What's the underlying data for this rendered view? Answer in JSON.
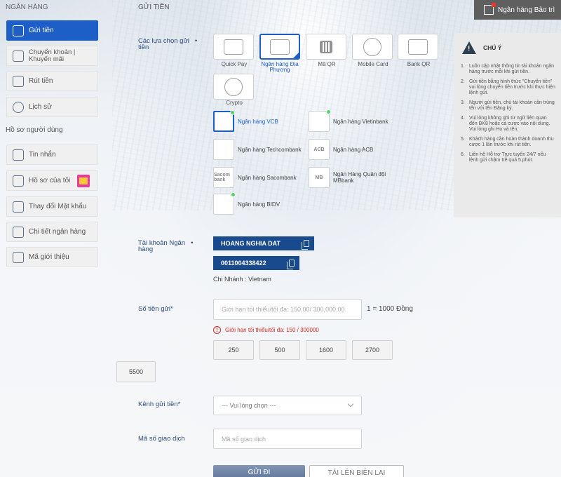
{
  "sidebar": {
    "title": "NGÂN HÀNG",
    "items": [
      {
        "label": "Gửi tiền",
        "icon": "deposit-icon"
      },
      {
        "label": "Chuyển khoản |",
        "label2": "Khuyến mãi",
        "icon": "transfer-icon"
      },
      {
        "label": "Rút tiền",
        "icon": "withdraw-icon"
      },
      {
        "label": "Lịch sử",
        "icon": "history-icon"
      }
    ],
    "profile_section": "Hồ sơ người dùng",
    "profile_items": [
      {
        "label": "Tin nhắn",
        "icon": "mail-icon"
      },
      {
        "label": "Hồ sơ của tôi",
        "icon": "profile-icon"
      },
      {
        "label": "Thay đổi Mật khẩu",
        "icon": "password-icon"
      },
      {
        "label": "Chi tiết ngân hàng",
        "icon": "bank-detail-icon"
      },
      {
        "label": "Mã giới thiệu",
        "icon": "referral-icon"
      }
    ]
  },
  "header": {
    "title": "GỬI TIỀN",
    "maintenance_label": "Ngân hàng Bảo trì"
  },
  "deposit": {
    "options_label": "Các lựa chọn gửi",
    "options_label2": "tiền",
    "options": [
      {
        "label": "Quick Pay",
        "icon": "fast-icon"
      },
      {
        "label": "Ngân hàng Địa",
        "label2": "Phương",
        "icon": "local-bank-icon",
        "selected": true
      },
      {
        "label": "Mã QR",
        "icon": "qr-icon"
      },
      {
        "label": "Mobile Card",
        "icon": "mobile-card-icon"
      },
      {
        "label": "Bank QR",
        "icon": "bank-qr-icon"
      },
      {
        "label": "Crypto",
        "icon": "crypto-icon"
      }
    ],
    "banks": [
      {
        "name": "Ngân hàng VCB",
        "logo": "vcb-logo",
        "selected": true
      },
      {
        "name": "Ngân hàng Vietinbank",
        "logo": "vietinbank-logo"
      },
      {
        "name": "Ngân hàng Techcombank",
        "logo": "techcombank-logo"
      },
      {
        "name": "Ngân hàng ACB",
        "logo": "ACB"
      },
      {
        "name": "Ngân hàng Sacombank",
        "logo": "Sacom bank"
      },
      {
        "name": "Ngân Hàng Quân đội",
        "name2": "MBbank",
        "logo": "MB"
      },
      {
        "name": "Ngân hàng BIDV",
        "logo": "bidv-logo"
      }
    ],
    "account_label": "Tài khoản Ngân",
    "account_label2": "hàng",
    "account_name": "HOANG NGHIA DAT",
    "account_number": "0011004338422",
    "branch": "Chi Nhánh : Vietnam",
    "amount_label": "Số tiền gửi*",
    "amount_placeholder": "Giới hạn tối thiểu/tối đa: 150.00/ 300,000.00",
    "rate": "1 = 1000 Đồng",
    "error": "Giới hạn tối thiểu/tối đa: 150 / 300000",
    "quick_amounts": [
      "250",
      "500",
      "1600",
      "2700",
      "5500"
    ],
    "channel_label": "Kênh gửi tiền*",
    "channel_placeholder": "--- Vui lòng chọn ---",
    "txn_label": "Mã số giao dịch",
    "txn_placeholder": "Mã số giao dịch",
    "submit": "GỬI ĐI",
    "reload": "TẢI LÊN BIÊN LAI"
  },
  "notice": {
    "title": "CHÚ Ý",
    "items": [
      "Luôn cập nhật thông tin tài khoản ngân hàng trước mỗi khi gửi tiền.",
      "Gửi tiền bằng hình thức \"Chuyển tiền\" vui lòng chuyển tiền trước khi thực hiện lệnh gửi.",
      "Người gửi tiền, chủ tài khoản cần trùng tên với tên Đăng ký.",
      "Vui lòng không ghi từ ngữ liên quan đến BK8 hoặc cá cược vào nội dung. Vui lòng ghi Họ và tên.",
      "Khách hàng cần hoàn thành doanh thu cược 1 lần trước khi rút tiền.",
      "Liên hệ Hỗ trợ Trực tuyến 24/7 nếu lệnh gửi chậm trễ quá 5 phút."
    ]
  },
  "colors": {
    "accent": "#1e5ec7",
    "account_bg": "#1a4a8e",
    "error": "#d9251d",
    "online_dot": "#4cd964"
  }
}
